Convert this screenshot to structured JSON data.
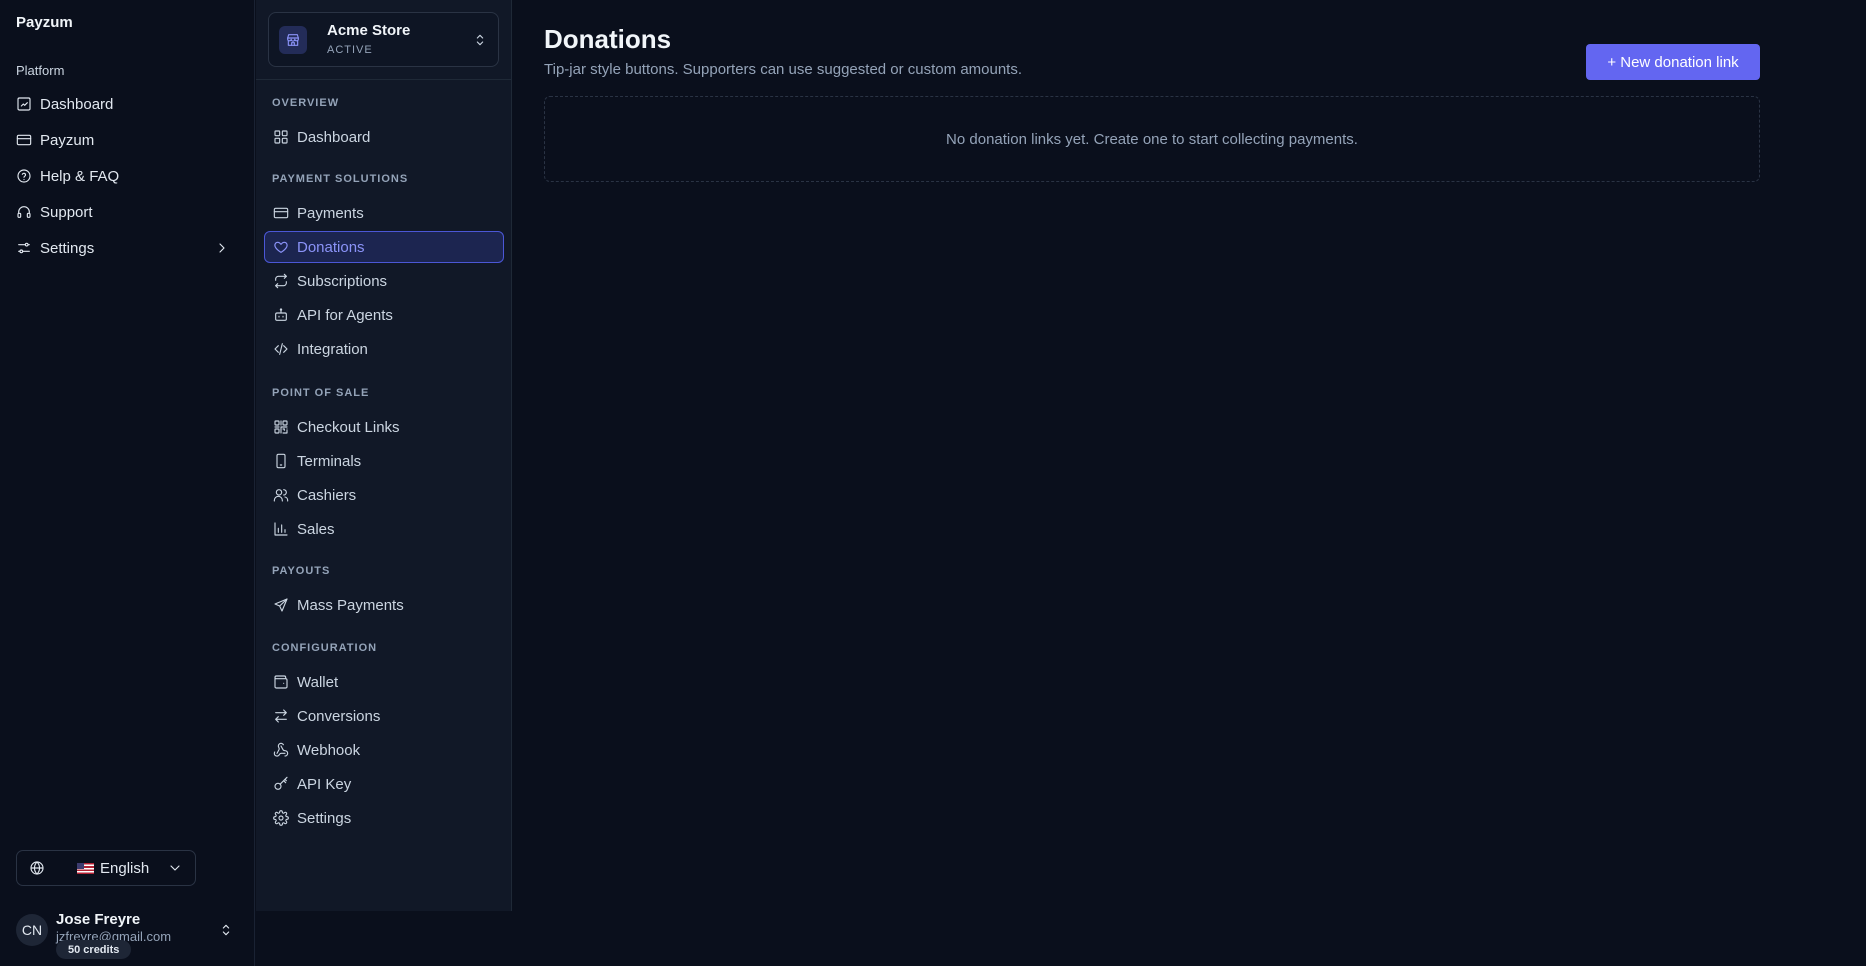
{
  "app": {
    "brand": "Payzum"
  },
  "left_sidebar": {
    "group_label": "Platform",
    "items": [
      {
        "label": "Dashboard",
        "icon": "dashboard-icon"
      },
      {
        "label": "Payzum",
        "icon": "card-icon"
      },
      {
        "label": "Help & FAQ",
        "icon": "help-circle-icon"
      },
      {
        "label": "Support",
        "icon": "headphones-icon"
      },
      {
        "label": "Settings",
        "icon": "sliders-icon",
        "has_submenu": true
      }
    ],
    "language": {
      "flag": "🇺🇸",
      "label": "English"
    },
    "user": {
      "initials": "CN",
      "name": "Jose Freyre",
      "email": "jzfreyre@gmail.com",
      "credits": "50 credits"
    }
  },
  "store": {
    "name": "Acme Store",
    "status": "ACTIVE"
  },
  "nav": {
    "sections": [
      {
        "title": "OVERVIEW",
        "items": [
          {
            "label": "Dashboard",
            "icon": "grid-icon"
          }
        ]
      },
      {
        "title": "PAYMENT SOLUTIONS",
        "items": [
          {
            "label": "Payments",
            "icon": "credit-card-icon"
          },
          {
            "label": "Donations",
            "icon": "heart-icon",
            "active": true
          },
          {
            "label": "Subscriptions",
            "icon": "repeat-icon"
          },
          {
            "label": "API for Agents",
            "icon": "bot-icon"
          },
          {
            "label": "Integration",
            "icon": "code-icon"
          }
        ]
      },
      {
        "title": "POINT OF SALE",
        "items": [
          {
            "label": "Checkout Links",
            "icon": "qr-code-icon"
          },
          {
            "label": "Terminals",
            "icon": "smartphone-icon"
          },
          {
            "label": "Cashiers",
            "icon": "users-icon"
          },
          {
            "label": "Sales",
            "icon": "bar-chart-icon"
          }
        ]
      },
      {
        "title": "PAYOUTS",
        "items": [
          {
            "label": "Mass Payments",
            "icon": "send-icon"
          }
        ]
      },
      {
        "title": "CONFIGURATION",
        "items": [
          {
            "label": "Wallet",
            "icon": "wallet-icon"
          },
          {
            "label": "Conversions",
            "icon": "arrows-exchange-icon"
          },
          {
            "label": "Webhook",
            "icon": "webhook-icon"
          },
          {
            "label": "API Key",
            "icon": "key-icon"
          },
          {
            "label": "Settings",
            "icon": "gear-icon"
          }
        ]
      }
    ]
  },
  "main": {
    "title": "Donations",
    "subtitle": "Tip-jar style buttons. Supporters can use suggested or custom amounts.",
    "new_button": "+ New donation link",
    "empty_state": "No donation links yet. Create one to start collecting payments."
  },
  "colors": {
    "background": "#0a0f1c",
    "nav_background": "#111827",
    "accent": "#6366f1",
    "active_text": "#8b93f8"
  }
}
